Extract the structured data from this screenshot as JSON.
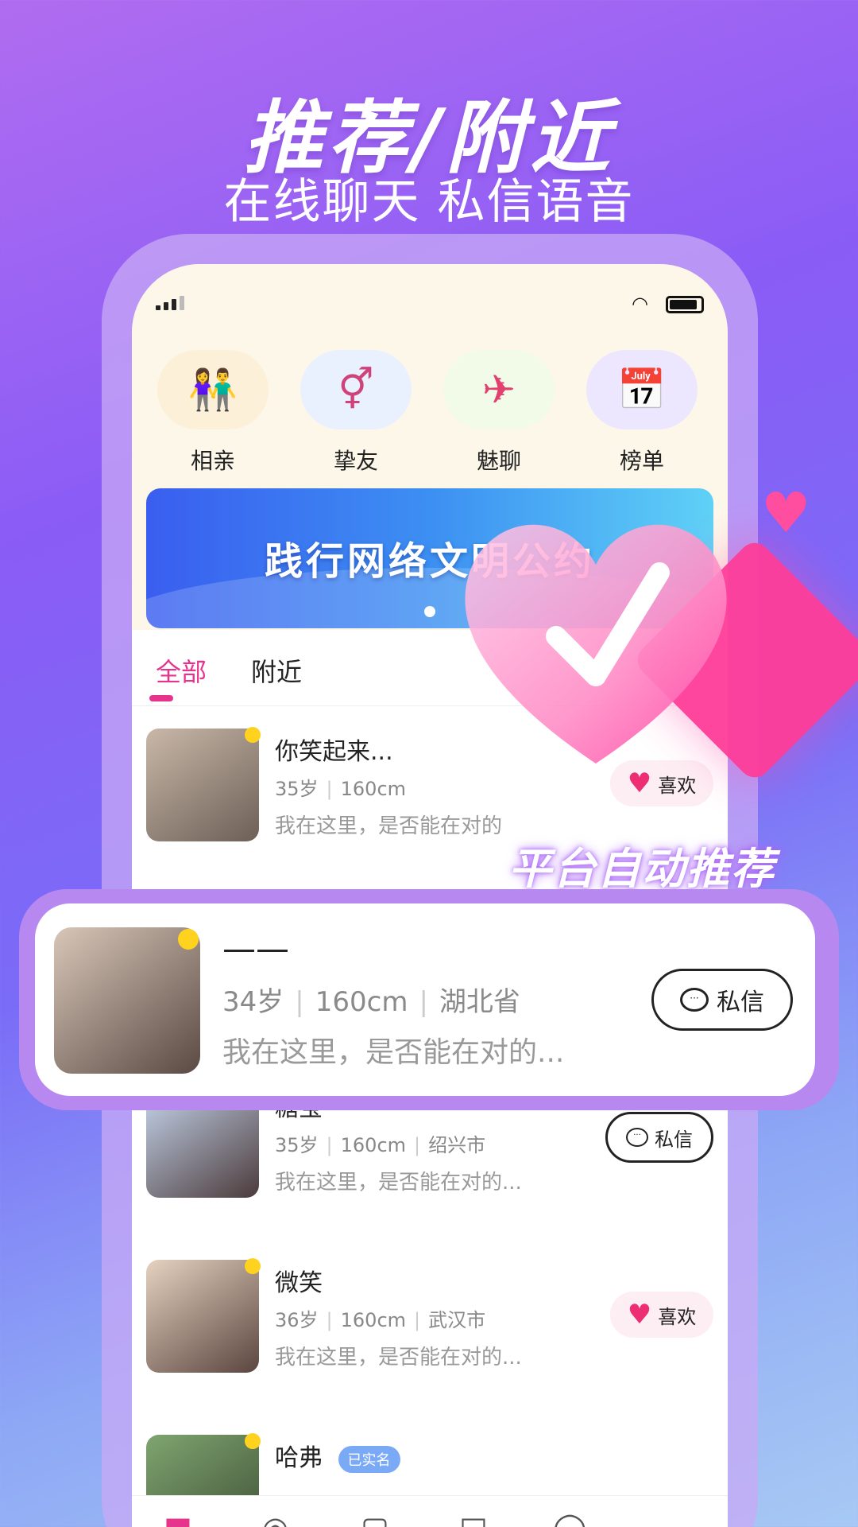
{
  "headline": "推荐/附近",
  "subline": "在线聊天 私信语音",
  "quick_nav": [
    {
      "label": "相亲",
      "icon": "couple-icon",
      "bg": "#fdf0d8"
    },
    {
      "label": "挚友",
      "icon": "gender-symbols-icon",
      "bg": "#eaf1fe"
    },
    {
      "label": "魅聊",
      "icon": "airplane-icon",
      "bg": "#f2fae8"
    },
    {
      "label": "榜单",
      "icon": "calendar-heart-icon",
      "bg": "#ece6ff"
    }
  ],
  "banner": {
    "text": "践行网络文明公约"
  },
  "tabs": [
    {
      "label": "全部",
      "active": true
    },
    {
      "label": "附近",
      "active": false
    }
  ],
  "promo_text": "平台自动推荐",
  "feed": [
    {
      "name": "你笑起来...",
      "age": "35岁",
      "height": "160cm",
      "location": "",
      "bio": "我在这里，是否能在对的",
      "action": "喜欢"
    },
    {
      "name": "糖宝",
      "age": "35岁",
      "height": "160cm",
      "location": "绍兴市",
      "bio": "我在这里，是否能在对的...",
      "action": "私信"
    },
    {
      "name": "微笑",
      "age": "36岁",
      "height": "160cm",
      "location": "武汉市",
      "bio": "我在这里，是否能在对的...",
      "action": "喜欢"
    },
    {
      "name": "哈弗",
      "verified": "已实名"
    }
  ],
  "highlight": {
    "name": "——",
    "age": "34岁",
    "height": "160cm",
    "location": "湖北省",
    "bio": "我在这里，是否能在对的...",
    "action": "私信"
  },
  "colors": {
    "accent": "#e6338c",
    "like_bg": "#fdeef3",
    "heart": "#ee2e72",
    "verified": "#7aa9f5"
  }
}
